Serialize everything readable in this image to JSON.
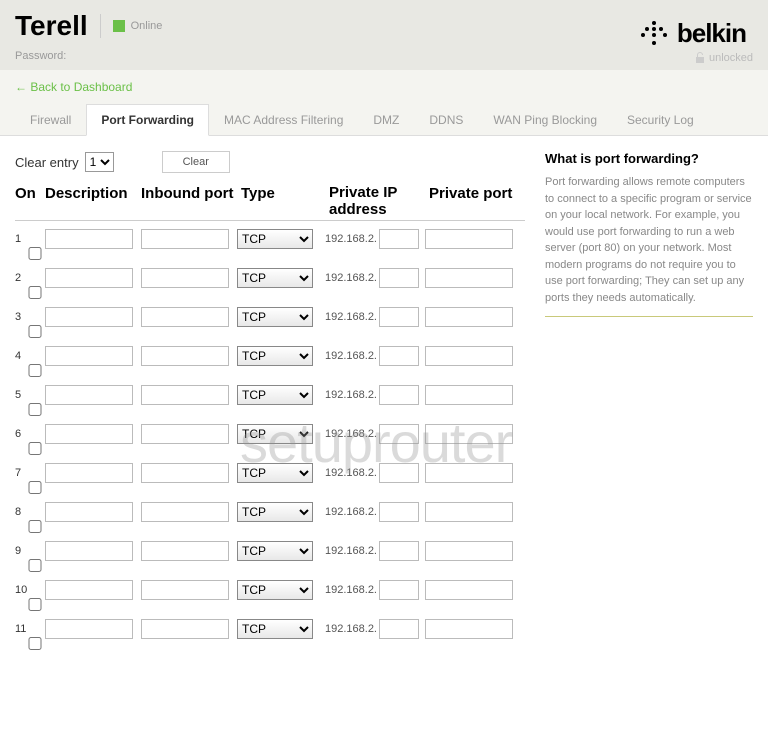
{
  "header": {
    "device_name": "Terell",
    "status": "Online",
    "password_label": "Password:",
    "brand": "belkin",
    "lock_status": "unlocked"
  },
  "nav": {
    "back_link": "← Back to Dashboard",
    "tabs": [
      {
        "label": "Firewall",
        "active": false
      },
      {
        "label": "Port Forwarding",
        "active": true
      },
      {
        "label": "MAC Address Filtering",
        "active": false
      },
      {
        "label": "DMZ",
        "active": false
      },
      {
        "label": "DDNS",
        "active": false
      },
      {
        "label": "WAN Ping Blocking",
        "active": false
      },
      {
        "label": "Security Log",
        "active": false
      }
    ]
  },
  "clear": {
    "label": "Clear entry",
    "selected": "1",
    "button": "Clear"
  },
  "columns": {
    "on": "On",
    "description": "Description",
    "inbound": "Inbound port",
    "type": "Type",
    "ip": "Private IP address",
    "port": "Private port"
  },
  "row_defaults": {
    "type_value": "TCP",
    "ip_prefix": "192.168.2."
  },
  "rows": [
    {
      "num": "1"
    },
    {
      "num": "2"
    },
    {
      "num": "3"
    },
    {
      "num": "4"
    },
    {
      "num": "5"
    },
    {
      "num": "6"
    },
    {
      "num": "7"
    },
    {
      "num": "8"
    },
    {
      "num": "9"
    },
    {
      "num": "10"
    },
    {
      "num": "11"
    }
  ],
  "side": {
    "title": "What is port forwarding?",
    "text": "Port forwarding allows remote computers to connect to a specific program or service on your local network. For example, you would use port forwarding to run a web server (port 80) on your network. Most modern programs do not require you to use port forwarding; They can set up any ports they needs automatically."
  },
  "watermark": "setuprouter"
}
